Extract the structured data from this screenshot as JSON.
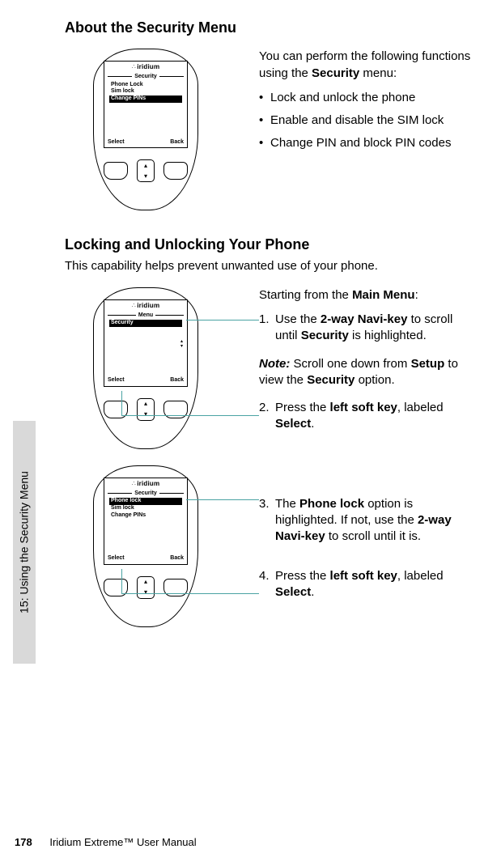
{
  "sideTab": "15: Using the Security Menu",
  "footer": {
    "page": "178",
    "title": "Iridium Extreme™ User Manual"
  },
  "section1": {
    "heading": "About the Security Menu",
    "intro_pre": "You can perform the following functions using the ",
    "intro_bold": "Security",
    "intro_post": " menu:",
    "bullets": [
      "Lock and unlock the phone",
      "Enable and disable the SIM lock",
      "Change PIN and block PIN codes"
    ],
    "phone": {
      "brand": "iridium",
      "title": "Security",
      "items": [
        "Phone Lock",
        "Sim lock",
        "Change PINs"
      ],
      "highlightIndex": 2,
      "softLeft": "Select",
      "softRight": "Back"
    }
  },
  "section2": {
    "heading": "Locking and Unlocking Your Phone",
    "desc": "This capability helps prevent unwanted use of your phone.",
    "lead_pre": "Starting from the ",
    "lead_bold": "Main Menu",
    "lead_post": ":",
    "step1": {
      "pre": "Use the ",
      "b1": "2-way Navi-key",
      "mid": " to scroll until ",
      "b2": "Security",
      "post": " is highlighted."
    },
    "note": {
      "label": "Note:",
      "pre": " Scroll one down from ",
      "b1": "Setup",
      "mid": " to view the ",
      "b2": "Security",
      "post": " option."
    },
    "step2": {
      "pre": "Press the ",
      "b1": "left soft key",
      "mid": ", labeled ",
      "b2": "Select",
      "post": "."
    },
    "phoneA": {
      "brand": "iridium",
      "title": "Menu",
      "items": [
        "Security"
      ],
      "highlightIndex": 0,
      "softLeft": "Select",
      "softRight": "Back",
      "showScrollArrows": true
    },
    "step3": {
      "pre": "The ",
      "b1": "Phone lock",
      "mid1": " option is highlighted. If not, use the ",
      "b2": "2-way Navi-key",
      "post": " to scroll until it is."
    },
    "step4": {
      "pre": "Press the ",
      "b1": "left soft key",
      "mid": ", labeled ",
      "b2": "Select",
      "post": "."
    },
    "phoneB": {
      "brand": "iridium",
      "title": "Security",
      "items": [
        "Phone lock",
        "Sim lock",
        "Change PINs"
      ],
      "highlightIndex": 0,
      "softLeft": "Select",
      "softRight": "Back"
    }
  }
}
